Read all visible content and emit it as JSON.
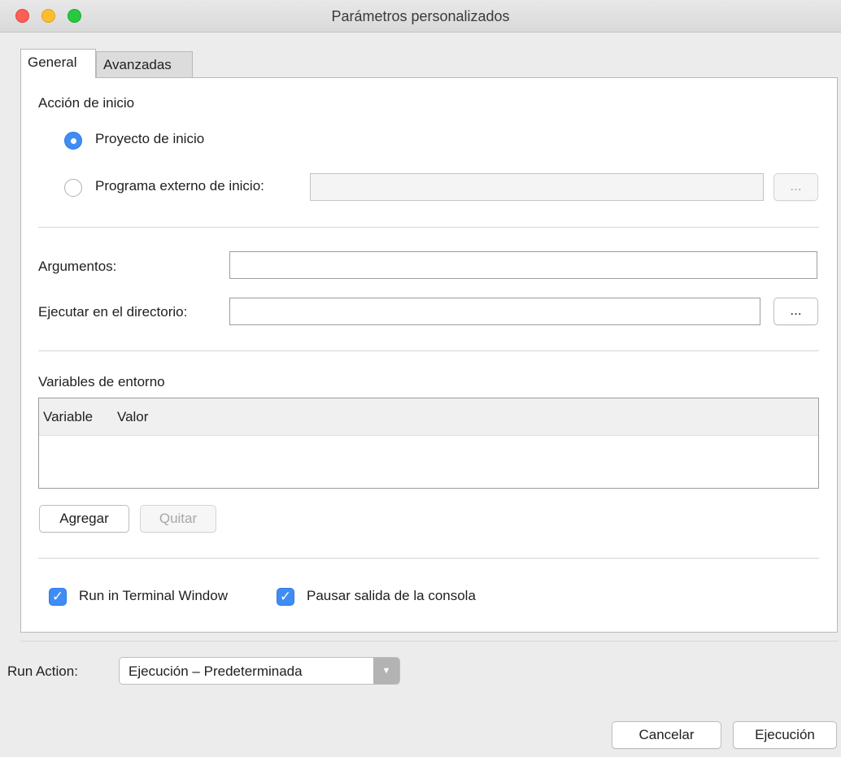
{
  "window": {
    "title": "Parámetros personalizados"
  },
  "tabs": [
    {
      "label": "General",
      "active": true
    },
    {
      "label": "Avanzadas",
      "active": false
    }
  ],
  "general": {
    "start_action_heading": "Acción de inicio",
    "start_project_label": "Proyecto de inicio",
    "start_project_selected": true,
    "external_program_label": "Programa externo de inicio:",
    "external_program_selected": false,
    "external_program_value": "",
    "browse_label": "...",
    "arguments_label": "Argumentos:",
    "arguments_value": "",
    "run_directory_label": "Ejecutar en el directorio:",
    "run_directory_value": "",
    "env_heading": "Variables de entorno",
    "env_columns": [
      "Variable",
      "Valor"
    ],
    "env_rows": [],
    "add_label": "Agregar",
    "remove_label": "Quitar",
    "run_in_terminal_label": "Run in Terminal Window",
    "run_in_terminal_checked": true,
    "pause_output_label": "Pausar salida de la consola",
    "pause_output_checked": true
  },
  "run_action": {
    "label": "Run Action:",
    "selected": "Ejecución – Predeterminada"
  },
  "footer": {
    "cancel_label": "Cancelar",
    "run_label": "Ejecución"
  },
  "colors": {
    "accent": "#3f8cf4",
    "traffic_red": "#fd5f57",
    "traffic_yellow": "#febc2e",
    "traffic_green": "#28c840"
  }
}
